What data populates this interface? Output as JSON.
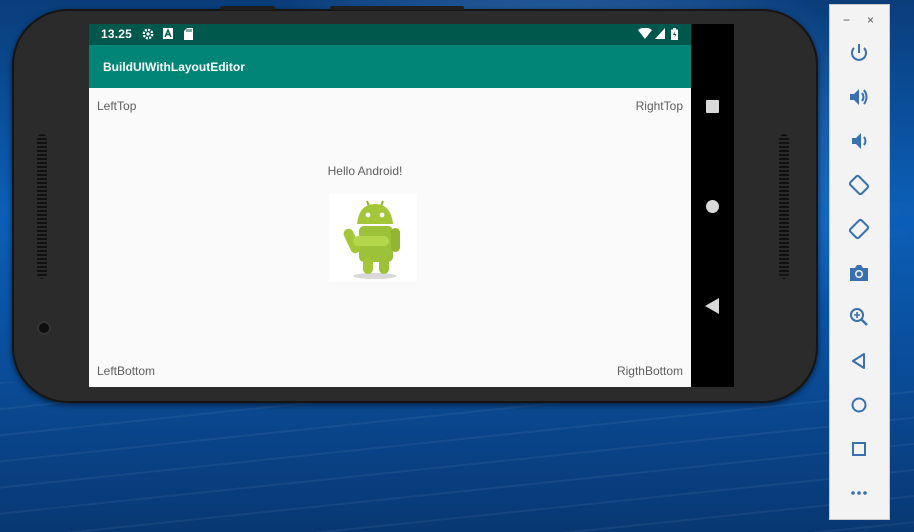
{
  "status_bar": {
    "time": "13.25"
  },
  "app_bar": {
    "title": "BuildUIWithLayoutEditor"
  },
  "content": {
    "left_top": "LeftTop",
    "right_top": "RightTop",
    "hello": "Hello Android!",
    "left_bottom": "LeftBottom",
    "right_bottom": "RigthBottom"
  },
  "emulator_toolbar": {
    "minimize": "−",
    "close": "×",
    "items": [
      "power-icon",
      "volume-up-icon",
      "volume-down-icon",
      "rotate-left-icon",
      "rotate-right-icon",
      "camera-icon",
      "zoom-icon",
      "back-icon",
      "home-icon",
      "overview-icon",
      "more-icon"
    ]
  },
  "colors": {
    "status_bar": "#00574b",
    "app_bar": "#008577",
    "screen_bg": "#fafafa",
    "label_text": "#5f5f5f",
    "android_green": "#a4c639"
  }
}
